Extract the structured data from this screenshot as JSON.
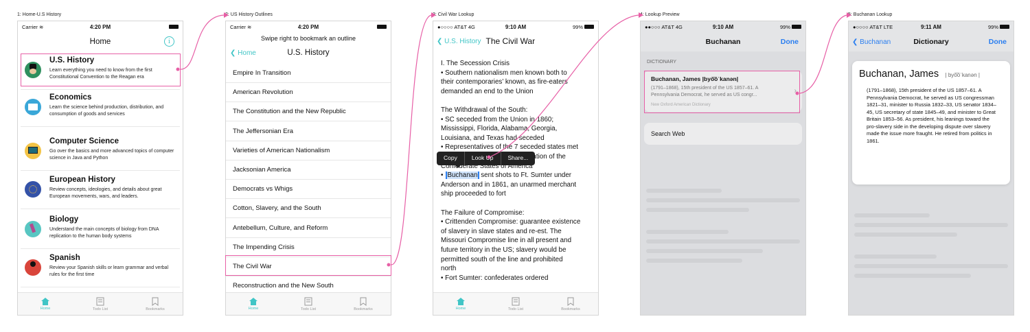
{
  "captions": [
    "1: Home-U.S History",
    "2: US History Outlines",
    "3: Civil War Lookup",
    "4: Lookup Preview",
    "5: Buchanan Lookup"
  ],
  "tabs": [
    "Home",
    "Todo List",
    "Bookmarks"
  ],
  "screen1": {
    "status": {
      "carrier": "Carrier",
      "time": "4:20 PM"
    },
    "title": "Home",
    "courses": [
      {
        "title": "U.S. History",
        "desc": "Learn everything you need to know from the first Constitutional Convention to the Reagan era"
      },
      {
        "title": "Economics",
        "desc": "Learn the science behind production, distribution, and consumption of goods and services"
      },
      {
        "title": "Computer Science",
        "desc": "Go over the basics and more advanced topics of computer science in Java and Python"
      },
      {
        "title": "European History",
        "desc": "Review concepts, ideologies, and details about great European movements, wars, and leaders."
      },
      {
        "title": "Biology",
        "desc": "Understand the main concepts of biology from DNA replication to the human body systems"
      },
      {
        "title": "Spanish",
        "desc": "Review your Spanish skills or learn grammar and verbal rules for the first time"
      }
    ],
    "colors": {
      "accent": "#40c5c6",
      "annotation": "#e75fa6"
    }
  },
  "screen2": {
    "status": {
      "carrier": "Carrier",
      "time": "4:20 PM"
    },
    "hint": "Swipe right to bookmark an outline",
    "back": "Home",
    "title": "U.S. History",
    "outlines": [
      "Empire In Transition",
      "American Revolution",
      "The Constitution and the New Republic",
      "The Jeffersonian Era",
      "Varieties of American Nationalism",
      "Jacksonian America",
      "Democrats vs Whigs",
      "Cotton, Slavery, and the South",
      "Antebellum, Culture, and Reform",
      "The Impending Crisis",
      "The Civil War",
      "Reconstruction and the New South"
    ]
  },
  "screen3": {
    "status": {
      "carrier": "●○○○○ AT&T  4G",
      "time": "9:10 AM",
      "battery": "99%"
    },
    "back": "U.S. History",
    "title": "The Civil War",
    "lines": [
      "I. The Secession Crisis",
      "• Southern nationalism men known both to",
      "their contemporaries’ known, as fire-eaters",
      "demanded an end to the Union",
      "",
      "The Withdrawal of the South:",
      "• SC seceded from the Union in 1860;",
      "Mississippi, Florida, Alabama, Georgia,",
      "Louisiana, and Texas had seceded",
      "• Representatives of the 7 seceded states met",
      "in Montgomery, AL for the formation of the",
      "Confederate States of America",
      " sent shots to Ft. Sumter under",
      "Anderson and in 1861, an unarmed merchant",
      "ship proceeded to fort",
      "",
      "The Failure of Compromise:",
      "• Crittenden Compromise: guarantee existence",
      "of slavery in slave states and re-est. The",
      "Missouri Compromise line in all present and",
      "future territory in the US; slavery would be",
      "permitted south of the line and prohibited",
      "north",
      "• Fort Sumter: confederates ordered"
    ],
    "selected_word": "Buchanan",
    "bullet": "•",
    "menu": [
      "Copy",
      "Look Up",
      "Share..."
    ]
  },
  "screen4": {
    "status": {
      "carrier": "●●○○○ AT&T  4G",
      "time": "9:10 AM",
      "battery": "99%"
    },
    "title": "Buchanan",
    "done": "Done",
    "section": "DICTIONARY",
    "entry_head": "Buchanan, James |byo͞oˈkanən|",
    "entry_text": "(1791–1868), 15th president of the US 1857–61. A Pennsylvania Democrat, he served as US congr...",
    "source": "New Oxford American Dictionary",
    "search_web": "Search Web"
  },
  "screen5": {
    "status": {
      "carrier": "●○○○○ AT&T  LTE",
      "time": "9:11 AM",
      "battery": "99%"
    },
    "back": "Buchanan",
    "title": "Dictionary",
    "done": "Done",
    "headword": "Buchanan, James",
    "pron": "| byo͞oˈkanən |",
    "definition": "(1791–1868), 15th president of the US 1857–61. A Pennsylvania Democrat, he served as US congressman 1821–31, minister to Russia 1832–33, US senator 1834–45, US secretary of state 1845–49, and minister to Great Britain 1853–56. As president, his leanings toward the pro-slavery side in the developing dispute over slavery made the issue more fraught. He retired from politics in 1861."
  }
}
